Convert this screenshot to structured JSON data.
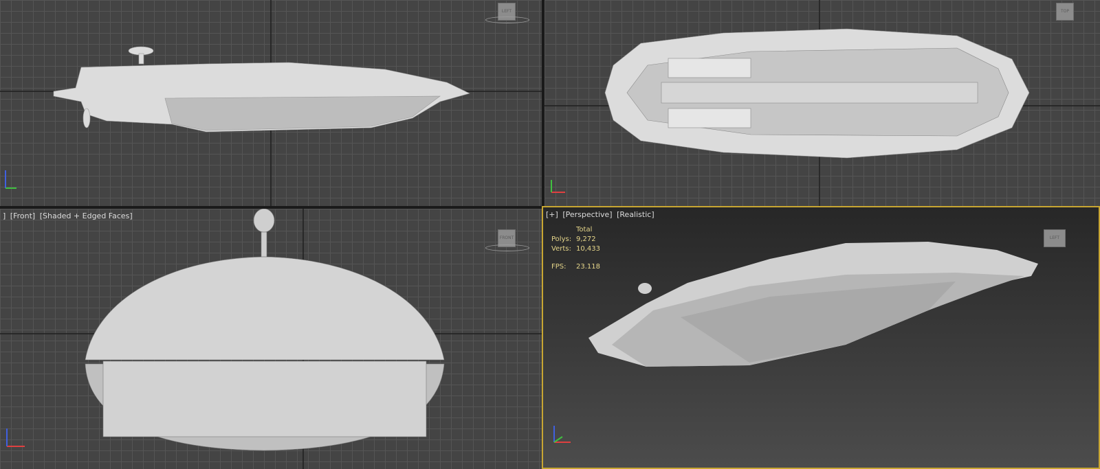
{
  "viewports": {
    "left": {
      "cube_label": "LEFT"
    },
    "top": {
      "cube_label": "TOP"
    },
    "front": {
      "label_parts": [
        "]",
        "[Front]",
        "[Shaded + Edged Faces]"
      ],
      "cube_label": "FRONT"
    },
    "perspective": {
      "label_parts": [
        "[+]",
        "[Perspective]",
        "[Realistic]"
      ],
      "cube_label": "LEFT",
      "stats": {
        "header": "Total",
        "polys_label": "Polys:",
        "polys": "9,272",
        "verts_label": "Verts:",
        "verts": "10,433",
        "fps_label": "FPS:",
        "fps": "23.118"
      }
    }
  },
  "colors": {
    "grid_bg": "#444444",
    "grid_line": "#555555",
    "active_border": "#c8a632",
    "stats_text": "#e6d68a",
    "axis_x": "#e04040",
    "axis_y": "#40c040",
    "axis_z": "#4060e0",
    "model": "#dcdcdc"
  },
  "icons": [
    "viewcube-icon",
    "axis-tripod-icon"
  ]
}
